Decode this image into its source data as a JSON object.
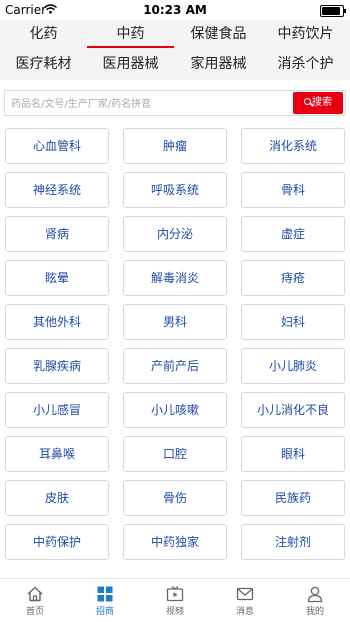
{
  "status_bar": {
    "carrier": "Carrier",
    "time": "10:23 AM"
  },
  "categories": [
    {
      "label": "化药",
      "active": false
    },
    {
      "label": "中药",
      "active": true
    },
    {
      "label": "保健食品",
      "active": false
    },
    {
      "label": "中药饮片",
      "active": false
    },
    {
      "label": "医疗耗材",
      "active": false
    },
    {
      "label": "医用器械",
      "active": false
    },
    {
      "label": "家用器械",
      "active": false
    },
    {
      "label": "消杀个护",
      "active": false
    }
  ],
  "search": {
    "placeholder": "药品名/文号/生产厂家/药名拼音",
    "button_label": "搜索"
  },
  "subcategories": [
    "心血管科",
    "肿瘤",
    "消化系统",
    "神经系统",
    "呼吸系统",
    "骨科",
    "肾病",
    "内分泌",
    "虚症",
    "眩晕",
    "解毒消炎",
    "痔疮",
    "其他外科",
    "男科",
    "妇科",
    "乳腺疾病",
    "产前产后",
    "小儿肺炎",
    "小儿感冒",
    "小儿咳嗽",
    "小儿消化不良",
    "耳鼻喉",
    "口腔",
    "眼科",
    "皮肤",
    "骨伤",
    "民族药",
    "中药保护",
    "中药独家",
    "注射剂"
  ],
  "tab_bar": [
    {
      "label": "首页",
      "icon": "home-icon"
    },
    {
      "label": "招商",
      "icon": "grid-icon"
    },
    {
      "label": "视频",
      "icon": "video-icon"
    },
    {
      "label": "消息",
      "icon": "mail-icon"
    },
    {
      "label": "我的",
      "icon": "user-icon"
    }
  ],
  "colors": {
    "accent_red": "#e60012",
    "link_blue": "#1f4aa8",
    "tab_active": "#1e7bd6"
  }
}
